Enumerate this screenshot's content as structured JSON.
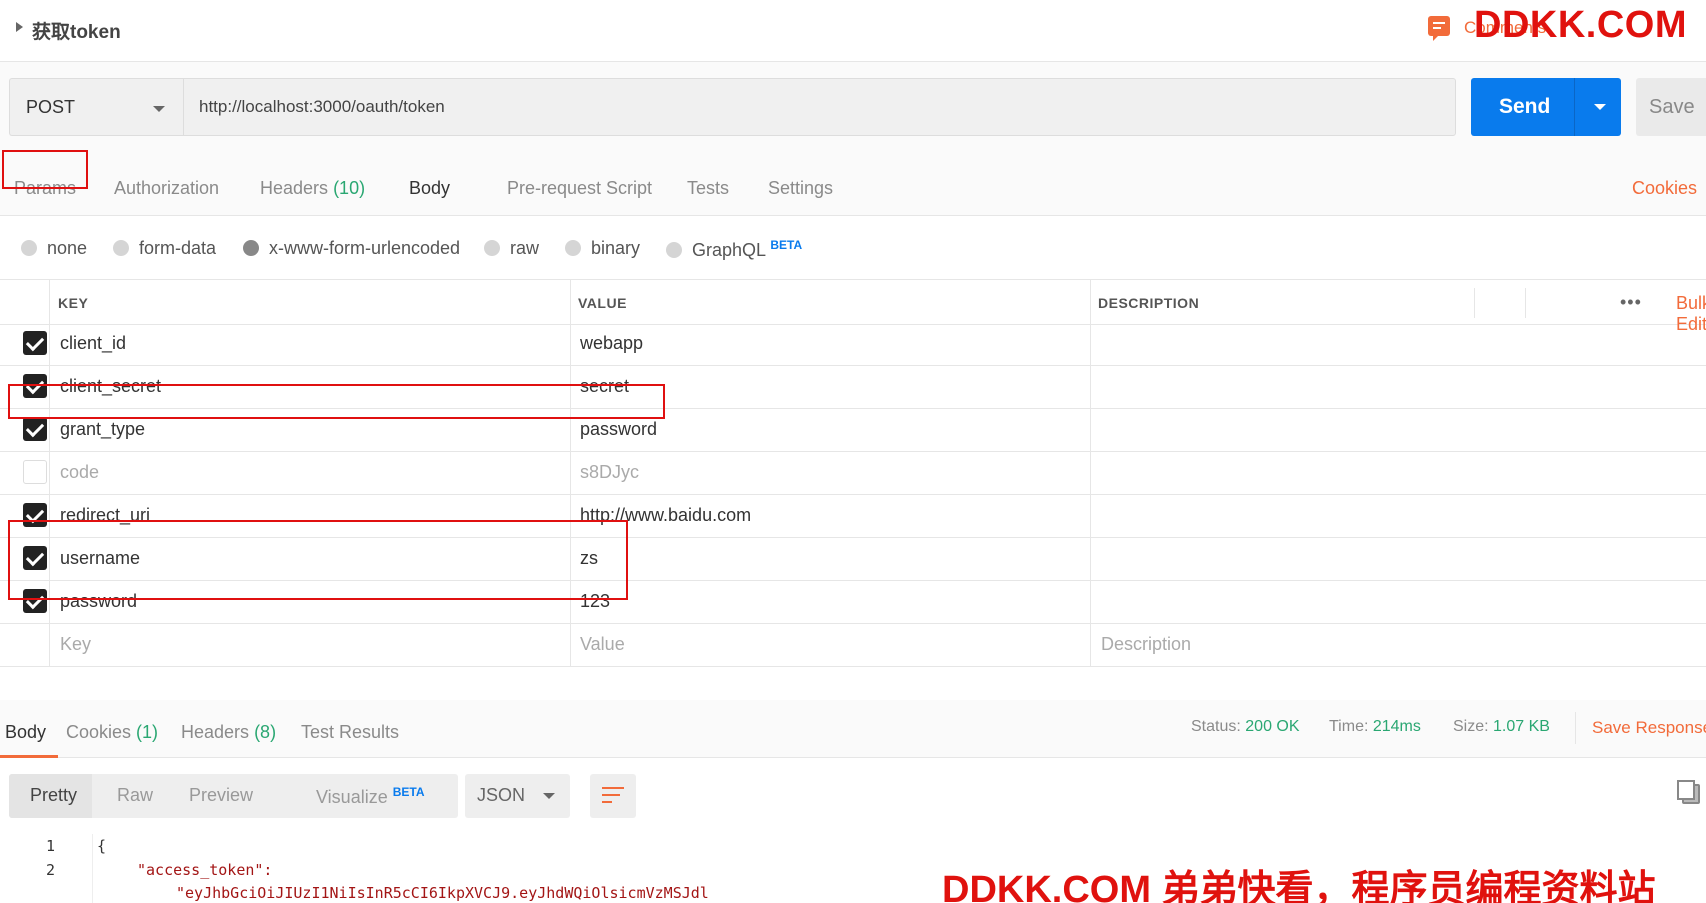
{
  "header": {
    "title": "获取token",
    "comments_label": "Comments",
    "watermark": "DDKK.COM"
  },
  "request": {
    "method": "POST",
    "url": "http://localhost:3000/oauth/token",
    "send_label": "Send",
    "save_label": "Save"
  },
  "tabs": {
    "params": "Params",
    "authorization": "Authorization",
    "headers": "Headers",
    "headers_count": "(10)",
    "body": "Body",
    "prerequest": "Pre-request Script",
    "tests": "Tests",
    "settings": "Settings",
    "cookies": "Cookies"
  },
  "body_types": {
    "none": "none",
    "form_data": "form-data",
    "urlencoded": "x-www-form-urlencoded",
    "raw": "raw",
    "binary": "binary",
    "graphql": "GraphQL",
    "beta": "BETA",
    "selected": "x-www-form-urlencoded"
  },
  "table": {
    "headers": {
      "key": "KEY",
      "value": "VALUE",
      "description": "DESCRIPTION",
      "bulk": "Bulk Edit",
      "more": "•••"
    },
    "rows": [
      {
        "checked": true,
        "key": "client_id",
        "value": "webapp"
      },
      {
        "checked": true,
        "key": "client_secret",
        "value": "secret"
      },
      {
        "checked": true,
        "key": "grant_type",
        "value": "password"
      },
      {
        "checked": false,
        "key": "code",
        "value": "s8DJyc"
      },
      {
        "checked": true,
        "key": "redirect_uri",
        "value": "http://www.baidu.com"
      },
      {
        "checked": true,
        "key": "username",
        "value": "zs"
      },
      {
        "checked": true,
        "key": "password",
        "value": "123"
      }
    ],
    "placeholders": {
      "key": "Key",
      "value": "Value",
      "description": "Description"
    }
  },
  "response": {
    "tabs": {
      "body": "Body",
      "cookies": "Cookies",
      "cookies_count": "(1)",
      "headers": "Headers",
      "headers_count": "(8)",
      "test_results": "Test Results"
    },
    "status_label": "Status:",
    "status_value": "200 OK",
    "time_label": "Time:",
    "time_value": "214ms",
    "size_label": "Size:",
    "size_value": "1.07 KB",
    "save_response": "Save Response",
    "views": {
      "pretty": "Pretty",
      "raw": "Raw",
      "preview": "Preview",
      "visualize": "Visualize",
      "beta": "BETA"
    },
    "format": "JSON",
    "code": {
      "line1_no": "1",
      "line2_no": "2",
      "line1": "{",
      "line2": "\"access_token\":",
      "line3": "\"eyJhbGciOiJIUzI1NiIsInR5cCI6IkpXVCJ9.eyJhdWQiOlsicmVzMSJdl"
    }
  },
  "watermark_bottom": "DDKK.COM 弟弟快看，程序员编程资料站"
}
